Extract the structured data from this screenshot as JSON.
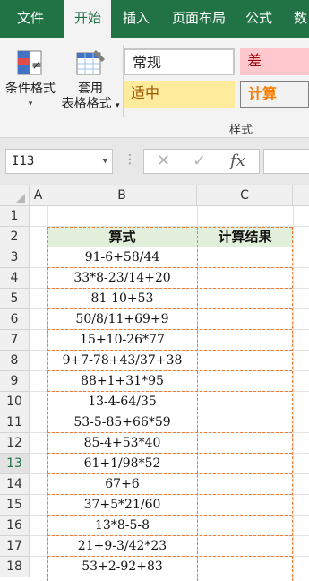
{
  "tabs": [
    {
      "label": "文件",
      "active": false
    },
    {
      "label": "开始",
      "active": true
    },
    {
      "label": "插入",
      "active": false
    },
    {
      "label": "页面布局",
      "active": false
    },
    {
      "label": "公式",
      "active": false
    },
    {
      "label": "数",
      "active": false
    }
  ],
  "ribbon": {
    "conditional_format_label": "条件格式",
    "table_format_label_1": "套用",
    "table_format_label_2": "表格格式",
    "styles": {
      "normal": "常规",
      "bad": "差",
      "neutral": "适中",
      "calculation": "计算"
    },
    "group_label": "样式"
  },
  "formula_bar": {
    "name_box": "I13",
    "cancel_icon": "close-icon",
    "enter_icon": "check-icon",
    "fx_label": "fx",
    "formula": ""
  },
  "sheet": {
    "columns": [
      "A",
      "B",
      "C"
    ],
    "rows": [
      {
        "num": "1",
        "b": "",
        "c": ""
      },
      {
        "num": "2",
        "b": "算式",
        "c": "计算结果"
      },
      {
        "num": "3",
        "b": "91-6+58/44",
        "c": ""
      },
      {
        "num": "4",
        "b": "33*8-23/14+20",
        "c": ""
      },
      {
        "num": "5",
        "b": "81-10+53",
        "c": ""
      },
      {
        "num": "6",
        "b": "50/8/11+69+9",
        "c": ""
      },
      {
        "num": "7",
        "b": "15+10-26*77",
        "c": ""
      },
      {
        "num": "8",
        "b": "9+7-78+43/37+38",
        "c": ""
      },
      {
        "num": "9",
        "b": "88+1+31*95",
        "c": ""
      },
      {
        "num": "10",
        "b": "13-4-64/35",
        "c": ""
      },
      {
        "num": "11",
        "b": "53-5-85+66*59",
        "c": ""
      },
      {
        "num": "12",
        "b": "85-4+53*40",
        "c": ""
      },
      {
        "num": "13",
        "b": "61+1/98*52",
        "c": ""
      },
      {
        "num": "14",
        "b": "67+6",
        "c": ""
      },
      {
        "num": "15",
        "b": "37+5*21/60",
        "c": ""
      },
      {
        "num": "16",
        "b": "13*8-5-8",
        "c": ""
      },
      {
        "num": "17",
        "b": "21+9-3/42*23",
        "c": ""
      },
      {
        "num": "18",
        "b": "53+2-92+83",
        "c": ""
      }
    ],
    "selected_row": "13",
    "colors": {
      "header_fill": "#e2efda",
      "dash_border": "#ed7d31",
      "accent": "#217346"
    }
  }
}
